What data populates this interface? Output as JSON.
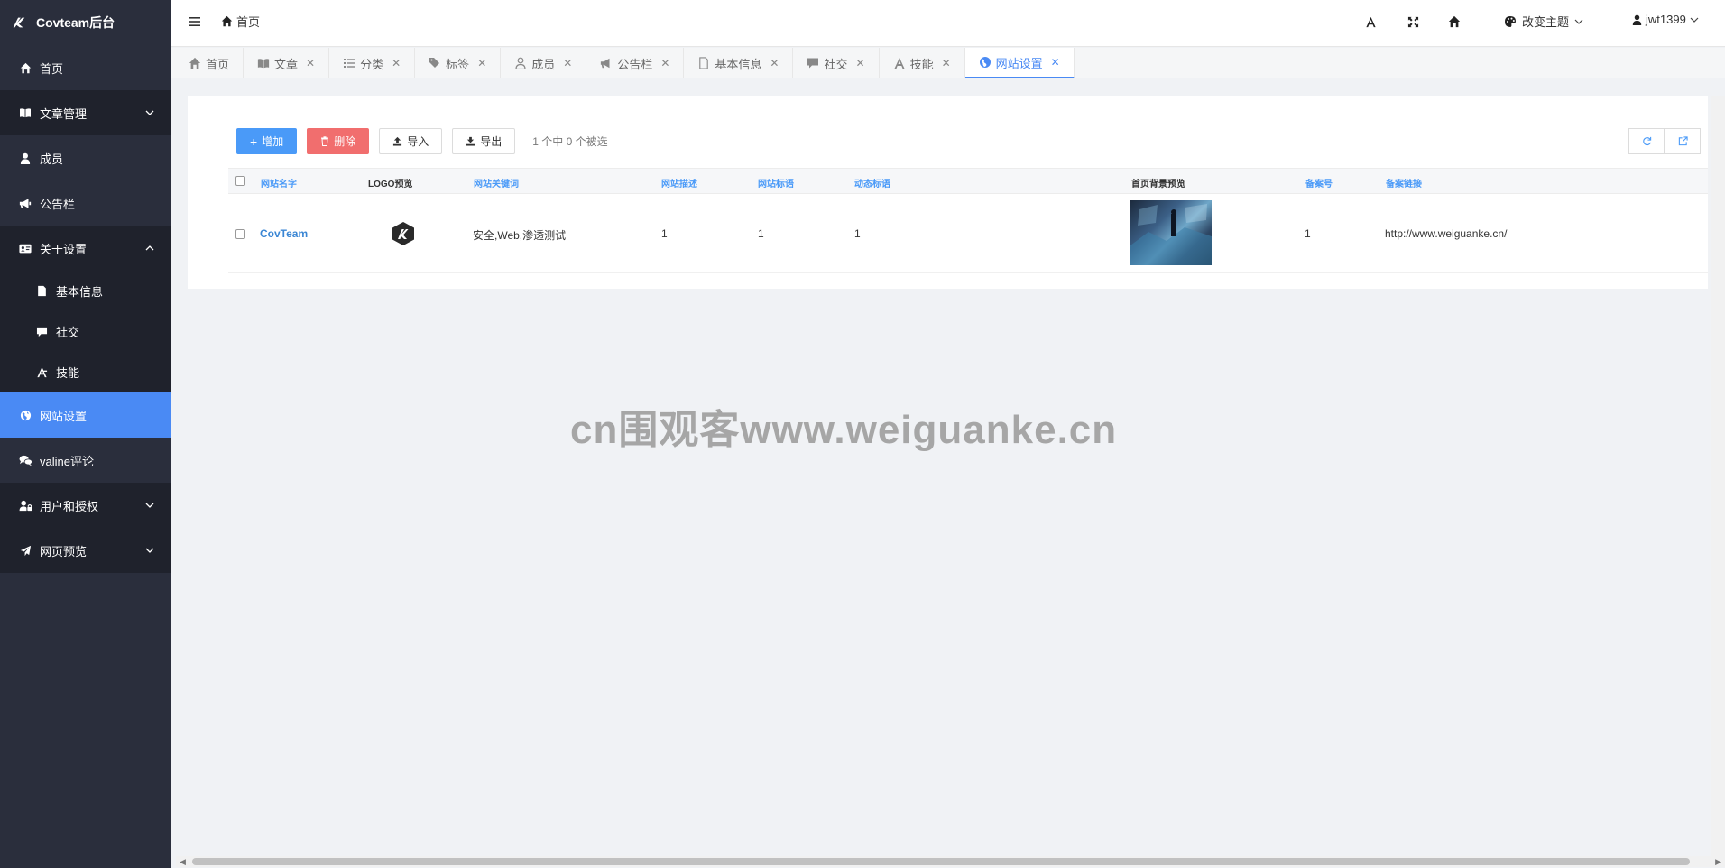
{
  "brand": {
    "title": "Covteam后台"
  },
  "sidebar": {
    "items": [
      {
        "label": "首页",
        "icon": "home-icon"
      },
      {
        "label": "文章管理",
        "icon": "book-icon"
      },
      {
        "label": "成员",
        "icon": "user-icon"
      },
      {
        "label": "公告栏",
        "icon": "megaphone-icon"
      },
      {
        "label": "关于设置",
        "icon": "id-card-icon"
      },
      {
        "label": "基本信息",
        "icon": "file-icon"
      },
      {
        "label": "社交",
        "icon": "comment-icon"
      },
      {
        "label": "技能",
        "icon": "skill-icon"
      },
      {
        "label": "网站设置",
        "icon": "globe-icon"
      },
      {
        "label": "valine评论",
        "icon": "comments-icon"
      },
      {
        "label": "用户和授权",
        "icon": "user-lock-icon"
      },
      {
        "label": "网页预览",
        "icon": "paper-plane-icon"
      }
    ]
  },
  "header": {
    "breadcrumb": "首页",
    "theme_label": "改变主题",
    "username": "jwt1399"
  },
  "tabs": [
    {
      "label": "首页"
    },
    {
      "label": "文章"
    },
    {
      "label": "分类"
    },
    {
      "label": "标签"
    },
    {
      "label": "成员"
    },
    {
      "label": "公告栏"
    },
    {
      "label": "基本信息"
    },
    {
      "label": "社交"
    },
    {
      "label": "技能"
    },
    {
      "label": "网站设置"
    }
  ],
  "toolbar": {
    "add_label": "增加",
    "delete_label": "删除",
    "import_label": "导入",
    "export_label": "导出",
    "selection_text": "1 个中 0 个被选"
  },
  "table": {
    "columns": [
      "网站名字",
      "LOGO预览",
      "网站关键词",
      "网站描述",
      "网站标语",
      "动态标语",
      "首页背景预览",
      "备案号",
      "备案链接"
    ],
    "rows": [
      {
        "name": "CovTeam",
        "keywords": "安全,Web,渗透测试",
        "description": "1",
        "slogan": "1",
        "dynamic_slogan": "1",
        "icp": "1",
        "icp_link": "http://www.weiguanke.cn/"
      }
    ]
  },
  "watermark": "cn围观客www.weiguanke.cn",
  "colors": {
    "sidebar_bg": "#2a2e3c",
    "accent": "#4a8af4",
    "danger": "#f16e6e"
  }
}
